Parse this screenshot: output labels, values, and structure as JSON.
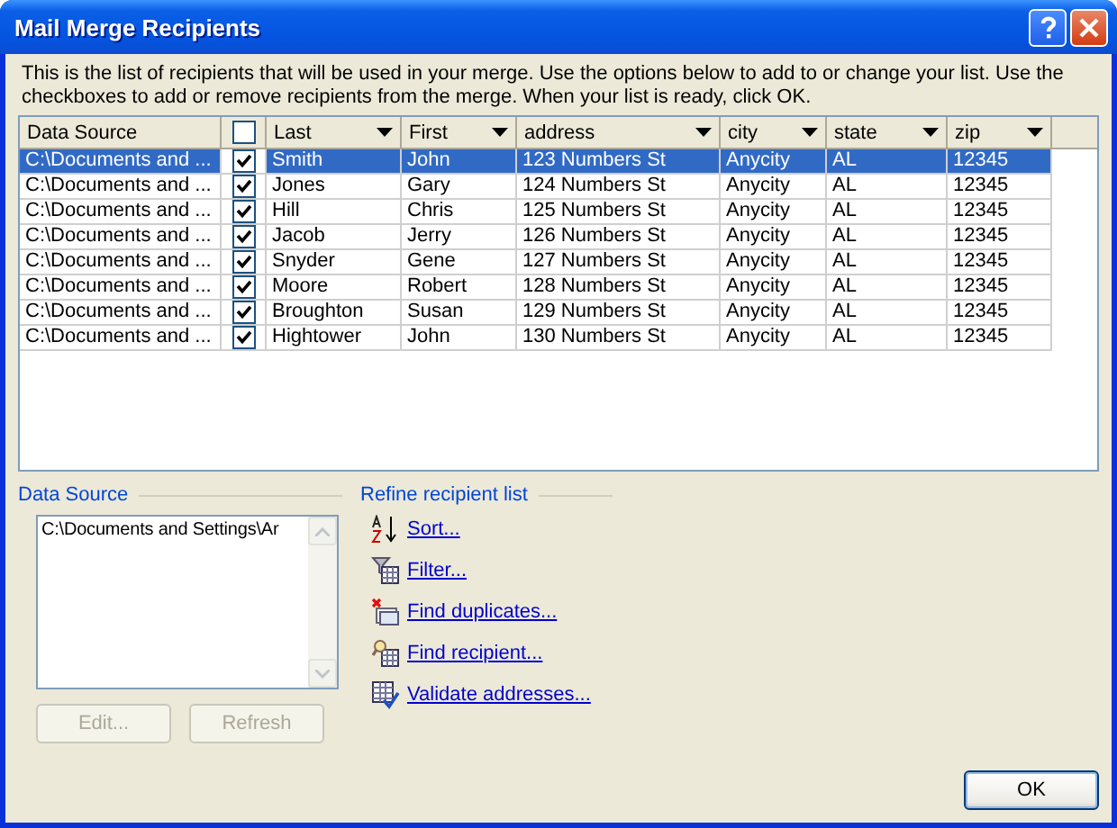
{
  "window": {
    "title": "Mail Merge Recipients"
  },
  "intro": "This is the list of recipients that will be used in your merge.  Use the options below to add to or change your list.  Use the checkboxes to add or remove recipients from the merge.  When your list is ready, click OK.",
  "table": {
    "select_all": {
      "checked": false
    },
    "columns": [
      {
        "kind": "plain",
        "label": "Data Source"
      },
      {
        "kind": "dropdown",
        "label": "Last"
      },
      {
        "kind": "dropdown",
        "label": "First"
      },
      {
        "kind": "dropdown",
        "label": "address"
      },
      {
        "kind": "dropdown",
        "label": "city"
      },
      {
        "kind": "dropdown",
        "label": "state"
      },
      {
        "kind": "dropdown",
        "label": "zip"
      }
    ],
    "rows": [
      {
        "selected": true,
        "checked": true,
        "cells": [
          "C:\\Documents and ...",
          "Smith",
          "John",
          "123 Numbers St",
          "Anycity",
          "AL",
          "12345"
        ]
      },
      {
        "selected": false,
        "checked": true,
        "cells": [
          "C:\\Documents and ...",
          "Jones",
          "Gary",
          "124 Numbers St",
          "Anycity",
          "AL",
          "12345"
        ]
      },
      {
        "selected": false,
        "checked": true,
        "cells": [
          "C:\\Documents and ...",
          "Hill",
          "Chris",
          "125 Numbers St",
          "Anycity",
          "AL",
          "12345"
        ]
      },
      {
        "selected": false,
        "checked": true,
        "cells": [
          "C:\\Documents and ...",
          "Jacob",
          "Jerry",
          "126 Numbers St",
          "Anycity",
          "AL",
          "12345"
        ]
      },
      {
        "selected": false,
        "checked": true,
        "cells": [
          "C:\\Documents and ...",
          "Snyder",
          "Gene",
          "127 Numbers St",
          "Anycity",
          "AL",
          "12345"
        ]
      },
      {
        "selected": false,
        "checked": true,
        "cells": [
          "C:\\Documents and ...",
          "Moore",
          "Robert",
          "128 Numbers St",
          "Anycity",
          "AL",
          "12345"
        ]
      },
      {
        "selected": false,
        "checked": true,
        "cells": [
          "C:\\Documents and ...",
          "Broughton",
          "Susan",
          "129 Numbers St",
          "Anycity",
          "AL",
          "12345"
        ]
      },
      {
        "selected": false,
        "checked": true,
        "cells": [
          "C:\\Documents and ...",
          "Hightower",
          "John",
          "130 Numbers St",
          "Anycity",
          "AL",
          "12345"
        ]
      }
    ]
  },
  "data_source": {
    "label": "Data Source",
    "items": [
      "C:\\Documents and Settings\\Ar"
    ],
    "buttons": [
      {
        "label": "Edit...",
        "disabled": true
      },
      {
        "label": "Refresh",
        "disabled": true
      }
    ]
  },
  "refine": {
    "label": "Refine recipient list",
    "links": [
      {
        "kind": "sort",
        "label": "Sort..."
      },
      {
        "kind": "filter",
        "label": "Filter..."
      },
      {
        "kind": "duplicates",
        "label": "Find duplicates..."
      },
      {
        "kind": "find",
        "label": "Find recipient..."
      },
      {
        "kind": "validate",
        "label": "Validate addresses..."
      }
    ]
  },
  "ok_button": "OK"
}
